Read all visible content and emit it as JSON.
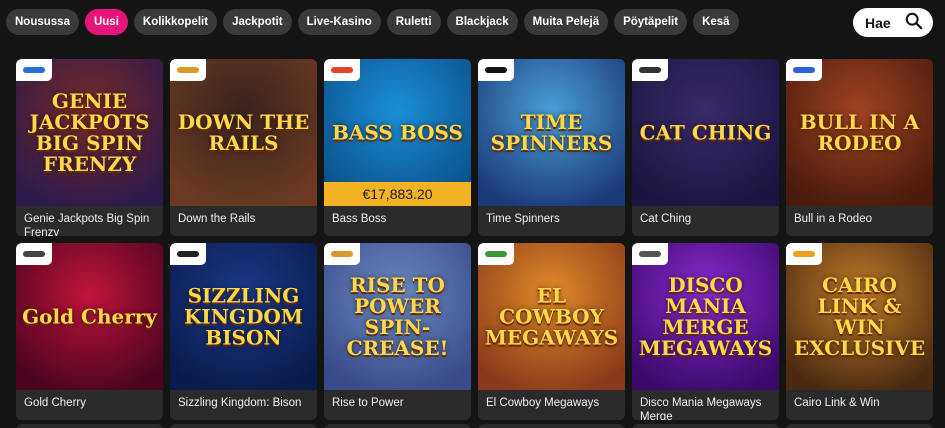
{
  "nav": {
    "tabs": [
      "Nousussa",
      "Uusi",
      "Kolikkopelit",
      "Jackpotit",
      "Live-Kasino",
      "Ruletti",
      "Blackjack",
      "Muita Pelejä",
      "Pöytäpelit",
      "Kesä"
    ],
    "active_tab": "Uusi"
  },
  "search": {
    "label": "Hae",
    "icon": "search-icon"
  },
  "games": [
    {
      "title": "Genie Jackpots Big Spin Frenzy",
      "logo": "GENIE JACKPOTS BIG SPIN FRENZY",
      "bg": "#7a2a2a",
      "bg2": "#2b1a4a",
      "provider_color": "#2a6fd6",
      "jackpot": ""
    },
    {
      "title": "Down the Rails",
      "logo": "DOWN THE RAILS",
      "bg": "#3a2420",
      "bg2": "#6b3a22",
      "provider_color": "#d99a2b",
      "jackpot": ""
    },
    {
      "title": "Bass Boss",
      "logo": "BASS BOSS",
      "bg": "#1a8fd6",
      "bg2": "#0c4f8a",
      "provider_color": "#e2452b",
      "jackpot": "€17,883.20"
    },
    {
      "title": "Time Spinners",
      "logo": "TIME SPINNERS",
      "bg": "#4a9fd6",
      "bg2": "#1b3a7a",
      "provider_color": "#111111",
      "jackpot": ""
    },
    {
      "title": "Cat Ching",
      "logo": "CAT CHING",
      "bg": "#3a2a6a",
      "bg2": "#1a1540",
      "provider_color": "#333333",
      "jackpot": ""
    },
    {
      "title": "Bull in a Rodeo",
      "logo": "BULL IN A RODEO",
      "bg": "#a04420",
      "bg2": "#4a1a0c",
      "provider_color": "#2a5fd6",
      "jackpot": ""
    },
    {
      "title": "Gold Cherry",
      "logo": "Gold Cherry",
      "bg": "#c0143a",
      "bg2": "#4a0420",
      "provider_color": "#444444",
      "jackpot": ""
    },
    {
      "title": "Sizzling Kingdom: Bison",
      "logo": "SIZZLING KINGDOM BISON",
      "bg": "#1a3a8a",
      "bg2": "#0a1a4a",
      "provider_color": "#222222",
      "jackpot": ""
    },
    {
      "title": "Rise to Power",
      "logo": "RISE TO POWER SPIN-CREASE!",
      "bg": "#6a8ac0",
      "bg2": "#3a4a8a",
      "provider_color": "#d99a2b",
      "jackpot": ""
    },
    {
      "title": "El Cowboy Megaways",
      "logo": "EL COWBOY MEGAWAYS",
      "bg": "#e08a2a",
      "bg2": "#8a3a1a",
      "provider_color": "#3a9a3a",
      "jackpot": ""
    },
    {
      "title": "Disco Mania Megaways Merge",
      "logo": "DISCO MANIA MERGE MEGAWAYS",
      "bg": "#8a2ad0",
      "bg2": "#3a0a6a",
      "provider_color": "#555555",
      "jackpot": ""
    },
    {
      "title": "Cairo Link & Win",
      "logo": "CAIRO LINK & WIN EXCLUSIVE",
      "bg": "#c07a2a",
      "bg2": "#4a2a10",
      "provider_color": "#f0a020",
      "jackpot": ""
    }
  ]
}
